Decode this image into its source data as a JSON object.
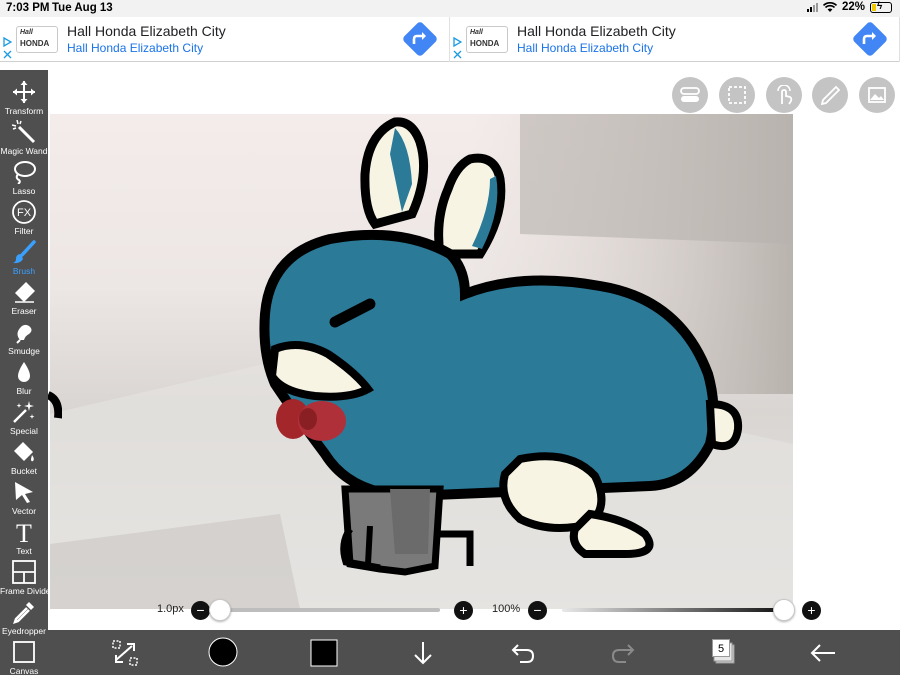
{
  "status_bar": {
    "time": "7:03 PM",
    "date": "Tue Aug 13",
    "battery_percent": "22%",
    "battery_level": 0.22
  },
  "ads": [
    {
      "title": "Hall Honda Elizabeth City",
      "subtitle": "Hall Honda Elizabeth City",
      "logo_text": "Hall",
      "logo_brand": "HONDA"
    },
    {
      "title": "Hall Honda Elizabeth City",
      "subtitle": "Hall Honda Elizabeth City",
      "logo_text": "Hall",
      "logo_brand": "HONDA"
    }
  ],
  "tools": [
    {
      "label": "Transform",
      "icon": "move-icon"
    },
    {
      "label": "Magic Wand",
      "icon": "magic-wand-icon"
    },
    {
      "label": "Lasso",
      "icon": "lasso-icon"
    },
    {
      "label": "Filter",
      "icon": "fx-icon"
    },
    {
      "label": "Brush",
      "icon": "brush-icon",
      "active": true
    },
    {
      "label": "Eraser",
      "icon": "eraser-icon"
    },
    {
      "label": "Smudge",
      "icon": "smudge-icon"
    },
    {
      "label": "Blur",
      "icon": "blur-drop-icon"
    },
    {
      "label": "Special",
      "icon": "sparkle-icon"
    },
    {
      "label": "Bucket",
      "icon": "bucket-icon"
    },
    {
      "label": "Vector",
      "icon": "cursor-icon"
    },
    {
      "label": "Text",
      "icon": "text-icon"
    },
    {
      "label": "Frame Divider",
      "icon": "frame-divider-icon"
    },
    {
      "label": "Eyedropper",
      "icon": "eyedropper-icon"
    },
    {
      "label": "Canvas",
      "icon": "canvas-icon"
    }
  ],
  "top_buttons": [
    "toggle-icon",
    "selection-icon",
    "touch-icon",
    "pen-icon",
    "reference-image-icon"
  ],
  "brush_size": {
    "label": "1.0px",
    "value_fraction": 0.0
  },
  "opacity": {
    "label": "100%",
    "value_fraction": 1.0
  },
  "bottom_bar": {
    "layer_count": "5",
    "brush_color": "#000000",
    "primary_color": "#000000"
  },
  "colors": {
    "toolbar_bg": "#4f4f4f",
    "active_tool": "#3aa0ff",
    "bunny_body": "#2b7a98",
    "bunny_cream": "#f8f4e4",
    "bow": "#a3262a",
    "legs_grey": "#7a7a7a"
  }
}
